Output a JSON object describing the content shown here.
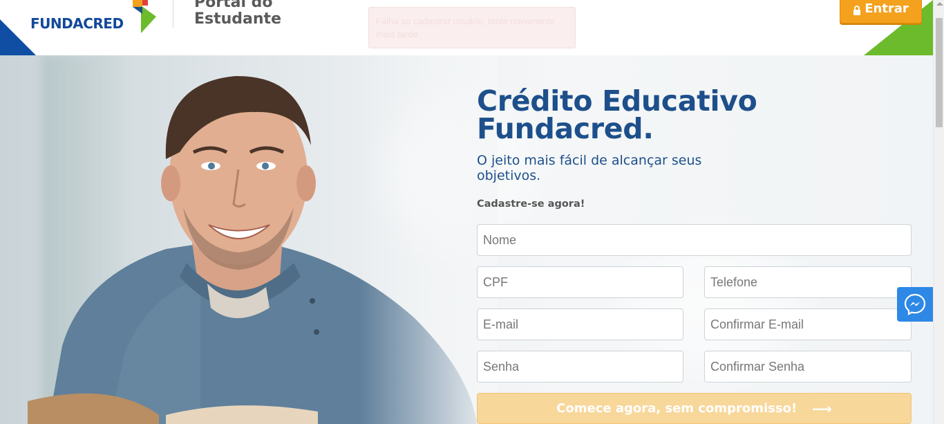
{
  "header": {
    "logo_text": "FUNDACRED",
    "portal_title_line1": "Portal do",
    "portal_title_line2": "Estudante",
    "login_label": "Entrar"
  },
  "alert": {
    "message": "Falha ao cadastrar usuário, tente novamente mais tarde"
  },
  "hero": {
    "headline_line1": "Crédito Educativo",
    "headline_line2": "Fundacred.",
    "subheadline": "O jeito mais fácil de alcançar seus objetivos.",
    "cta_label": "Cadastre-se agora!"
  },
  "form": {
    "nome_placeholder": "Nome",
    "cpf_placeholder": "CPF",
    "telefone_placeholder": "Telefone",
    "email_placeholder": "E-mail",
    "confirm_email_placeholder": "Confirmar E-mail",
    "senha_placeholder": "Senha",
    "confirm_senha_placeholder": "Confirmar Senha",
    "submit_label": "Comece agora, sem compromisso!",
    "submit_arrow": "⟶"
  },
  "icons": {
    "lock": "lock-icon",
    "messenger": "messenger-icon",
    "arrow": "arrow-right-icon"
  },
  "colors": {
    "brand_blue": "#1d4f8b",
    "login_orange": "#f4a11e",
    "submit_disabled": "#f8d79a",
    "messenger_blue": "#2d88e6",
    "accent_green": "#6cbb2c"
  }
}
